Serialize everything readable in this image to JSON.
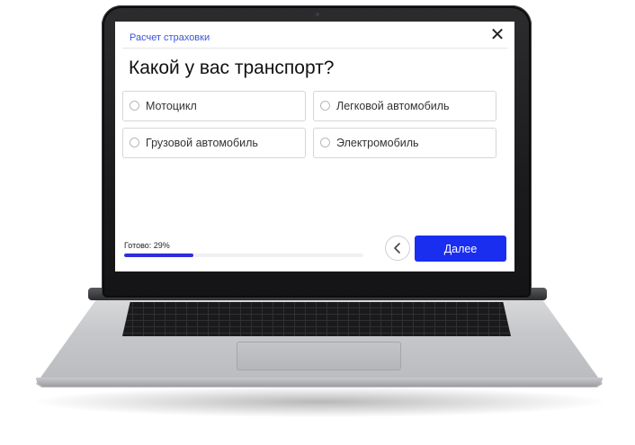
{
  "header": {
    "breadcrumb": "Расчет страховки",
    "close_icon": "close-icon"
  },
  "question": "Какой у вас транспорт?",
  "options": [
    {
      "label": "Мотоцикл",
      "selected": false
    },
    {
      "label": "Легковой автомобиль",
      "selected": false
    },
    {
      "label": "Грузовой автомобиль",
      "selected": false
    },
    {
      "label": "Электромобиль",
      "selected": false
    }
  ],
  "progress": {
    "label": "Готово: 29%",
    "value": 0.29
  },
  "nav": {
    "back_icon": "chevron-left-icon",
    "next_label": "Далее"
  },
  "colors": {
    "accent": "#1a2ef0",
    "progress_fill": "#2b2ed9",
    "breadcrumb": "#3b56d8"
  }
}
